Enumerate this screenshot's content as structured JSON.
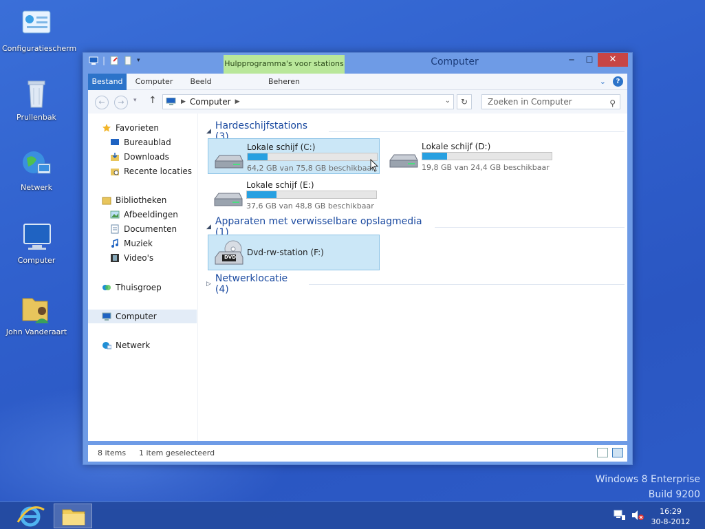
{
  "desktop": {
    "icons": [
      {
        "label": "Configuratiescherm",
        "icon": "control-panel-icon"
      },
      {
        "label": "Prullenbak",
        "icon": "recycle-bin-icon"
      },
      {
        "label": "Netwerk",
        "icon": "network-globe-icon"
      },
      {
        "label": "Computer",
        "icon": "computer-icon"
      },
      {
        "label": "John Vanderaart",
        "icon": "user-folder-icon"
      }
    ],
    "watermark": {
      "line1": "Windows 8 Enterprise",
      "line2": "Build 9200"
    }
  },
  "window": {
    "title": "Computer",
    "context_tab": "Hulpprogramma's voor stations",
    "ribbon_tabs": [
      "Bestand",
      "Computer",
      "Beeld",
      "Beheren"
    ],
    "address": {
      "crumb": "Computer"
    },
    "search": {
      "placeholder": "Zoeken in Computer"
    },
    "nav_pane": {
      "favorites": {
        "label": "Favorieten",
        "items": [
          "Bureaublad",
          "Downloads",
          "Recente locaties"
        ]
      },
      "libraries": {
        "label": "Bibliotheken",
        "items": [
          "Afbeeldingen",
          "Documenten",
          "Muziek",
          "Video's"
        ]
      },
      "homegroup": "Thuisgroep",
      "computer": "Computer",
      "network": "Netwerk"
    },
    "groups": {
      "hard_drives": {
        "header": "Hardeschijfstations (3)",
        "drives": [
          {
            "name": "Lokale schijf (C:)",
            "free_text": "64,2 GB van 75,8 GB beschikbaar",
            "used_fraction": 0.153
          },
          {
            "name": "Lokale schijf (D:)",
            "free_text": "19,8 GB van 24,4 GB beschikbaar",
            "used_fraction": 0.189
          },
          {
            "name": "Lokale schijf (E:)",
            "free_text": "37,6 GB van 48,8 GB beschikbaar",
            "used_fraction": 0.23
          }
        ]
      },
      "removable": {
        "header": "Apparaten met verwisselbare opslagmedia (1)",
        "devices": [
          {
            "name": "Dvd-rw-station (F:)",
            "badge": "DVD"
          }
        ]
      },
      "network": {
        "header": "Netwerklocatie (4)"
      }
    },
    "status": {
      "items": "8 items",
      "selected": "1 item geselecteerd"
    }
  },
  "taskbar": {
    "clock_time": "16:29",
    "clock_date": "30-8-2012"
  }
}
